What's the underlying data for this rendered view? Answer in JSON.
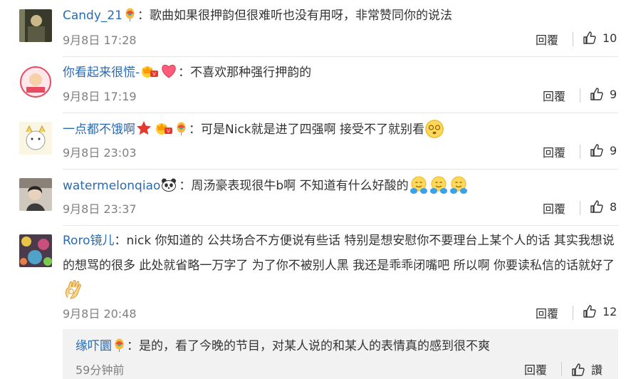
{
  "comments": [
    {
      "user": "Candy_21",
      "text": "：歌曲如果很押韵但很难听也没有用呀，非常赞同你的说法",
      "time": "9月8日 17:28",
      "reply": "回覆",
      "likes": "10",
      "badges": [
        "balloon-badge-icon"
      ]
    },
    {
      "user": "你看起来很慌-",
      "text": "：不喜欢那种强行押韵的",
      "time": "9月8日 17:19",
      "reply": "回覆",
      "likes": "9",
      "badges": [
        "vip-badge-icon",
        "heart-badge-icon"
      ]
    },
    {
      "user": "一点都不饿啊",
      "text": "：可是Nick就是进了四强啊 接受不了就别看",
      "time": "9月8日 23:03",
      "reply": "回覆",
      "likes": "9",
      "badges": [
        "star-badge-icon",
        "vip-badge-icon",
        "balloon-badge-icon"
      ]
    },
    {
      "user": "watermelonqiao",
      "text": "：周汤豪表现很牛b啊 不知道有什么好酸的",
      "time": "9月8日 23:37",
      "reply": "回覆",
      "likes": "8",
      "badges": [
        "panda-badge-icon"
      ]
    },
    {
      "user": "Roro镜儿",
      "text": "：nick 你知道的 公共场合不方便说有些话 特别是想安慰你不要理台上某个人的话 其实我想说的想骂的很多 此处就省略一万字了 为了你不被别人黑 我还是乖乖闭嘴吧 所以啊 你要读私信的话就好了",
      "time": "9月8日 20:48",
      "reply": "回覆",
      "likes": "12",
      "badges": []
    }
  ],
  "sub_reply": {
    "user": "缘吓圜",
    "text": "：是的，看了今晚的节目，对某人说的和某人的表情真的感到很不爽",
    "time": "59分钟前",
    "reply": "回覆",
    "likes": "讚",
    "badges": [
      "balloon-badge-icon"
    ]
  },
  "colors": {
    "username": "#2a6bb2",
    "time": "#808080",
    "divider": "#e6e6e6",
    "sub_reply_bg": "#f2f2f2"
  }
}
